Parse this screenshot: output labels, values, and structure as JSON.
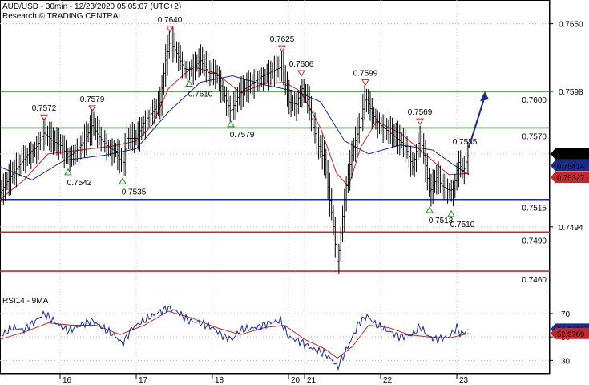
{
  "header": {
    "symbol_line": "AUD/USD - 30min - 12/23/2020 05:05:07 (UTC+2)",
    "research_line": "Research © TRADING CENTRAL"
  },
  "chart_data": [
    {
      "type": "candlestick",
      "title": "AUD/USD - 30min - 12/23/2020 05:05:07 (UTC+2)",
      "x_ticks": [
        "16",
        "17",
        "18",
        "20",
        "21",
        "22",
        "23"
      ],
      "y_ticks": [
        "0.7650",
        "0.7598",
        "0.7550",
        "0.7494"
      ],
      "ylim": [
        0.7444,
        0.7667
      ],
      "price_path": [
        [
          0,
          0.752
        ],
        [
          8,
          0.7528
        ],
        [
          20,
          0.7538
        ],
        [
          35,
          0.755
        ],
        [
          45,
          0.7555
        ],
        [
          55,
          0.7566
        ],
        [
          65,
          0.756
        ],
        [
          75,
          0.7557
        ],
        [
          85,
          0.7548
        ],
        [
          95,
          0.7552
        ],
        [
          105,
          0.756
        ],
        [
          115,
          0.7572
        ],
        [
          125,
          0.7562
        ],
        [
          135,
          0.7555
        ],
        [
          145,
          0.7552
        ],
        [
          153,
          0.754
        ],
        [
          158,
          0.7562
        ],
        [
          170,
          0.7562
        ],
        [
          180,
          0.7575
        ],
        [
          190,
          0.7582
        ],
        [
          200,
          0.759
        ],
        [
          206,
          0.762
        ],
        [
          212,
          0.7637
        ],
        [
          220,
          0.7628
        ],
        [
          230,
          0.7615
        ],
        [
          238,
          0.7615
        ],
        [
          250,
          0.7622
        ],
        [
          260,
          0.7612
        ],
        [
          270,
          0.7612
        ],
        [
          280,
          0.7595
        ],
        [
          288,
          0.7582
        ],
        [
          296,
          0.7593
        ],
        [
          305,
          0.76
        ],
        [
          315,
          0.7604
        ],
        [
          325,
          0.7609
        ],
        [
          335,
          0.7612
        ],
        [
          345,
          0.7615
        ],
        [
          352,
          0.7617
        ],
        [
          360,
          0.759
        ],
        [
          370,
          0.7588
        ],
        [
          376,
          0.7601
        ],
        [
          383,
          0.7594
        ],
        [
          390,
          0.7572
        ],
        [
          398,
          0.7555
        ],
        [
          405,
          0.7545
        ],
        [
          410,
          0.752
        ],
        [
          415,
          0.75
        ],
        [
          421,
          0.7465
        ],
        [
          428,
          0.7505
        ],
        [
          433,
          0.753
        ],
        [
          440,
          0.7552
        ],
        [
          448,
          0.757
        ],
        [
          456,
          0.7594
        ],
        [
          465,
          0.758
        ],
        [
          475,
          0.7572
        ],
        [
          485,
          0.7567
        ],
        [
          495,
          0.7562
        ],
        [
          505,
          0.7557
        ],
        [
          515,
          0.754
        ],
        [
          524,
          0.7564
        ],
        [
          530,
          0.7545
        ],
        [
          536,
          0.752
        ],
        [
          545,
          0.7532
        ],
        [
          552,
          0.7525
        ],
        [
          560,
          0.7522
        ],
        [
          566,
          0.7523
        ],
        [
          572,
          0.7544
        ],
        [
          578,
          0.7536
        ],
        [
          585,
          0.7551
        ]
      ],
      "ma_fast": [
        [
          0,
          0.7515
        ],
        [
          30,
          0.753
        ],
        [
          60,
          0.755
        ],
        [
          100,
          0.7553
        ],
        [
          140,
          0.7556
        ],
        [
          170,
          0.756
        ],
        [
          190,
          0.7572
        ],
        [
          210,
          0.76
        ],
        [
          240,
          0.7617
        ],
        [
          270,
          0.7612
        ],
        [
          300,
          0.7597
        ],
        [
          330,
          0.7604
        ],
        [
          355,
          0.7605
        ],
        [
          375,
          0.7598
        ],
        [
          400,
          0.757
        ],
        [
          420,
          0.7535
        ],
        [
          435,
          0.7525
        ],
        [
          450,
          0.7555
        ],
        [
          470,
          0.7575
        ],
        [
          500,
          0.7566
        ],
        [
          530,
          0.755
        ],
        [
          560,
          0.7534
        ],
        [
          585,
          0.7535
        ]
      ],
      "ma_slow": [
        [
          0,
          0.754
        ],
        [
          40,
          0.753
        ],
        [
          80,
          0.7545
        ],
        [
          130,
          0.7549
        ],
        [
          170,
          0.7554
        ],
        [
          210,
          0.7582
        ],
        [
          250,
          0.7605
        ],
        [
          290,
          0.761
        ],
        [
          330,
          0.7603
        ],
        [
          370,
          0.7598
        ],
        [
          400,
          0.759
        ],
        [
          430,
          0.756
        ],
        [
          460,
          0.755
        ],
        [
          500,
          0.7557
        ],
        [
          540,
          0.7553
        ],
        [
          570,
          0.754
        ],
        [
          585,
          0.7534
        ]
      ],
      "levels": [
        {
          "label": "0.7600",
          "value": 0.7598,
          "color": "#2b8a2b"
        },
        {
          "label": "0.7570",
          "value": 0.757,
          "color": "#2b8a2b"
        },
        {
          "label": "0.7515",
          "value": 0.7515,
          "color": "#1c2a88"
        },
        {
          "label": "0.7490",
          "value": 0.749,
          "color": "#c0282d"
        },
        {
          "label": "0.7460",
          "value": 0.746,
          "color": "#c0282d"
        }
      ],
      "price_tags": [
        {
          "label": "0.75503",
          "value": 0.755,
          "color": "#000000"
        },
        {
          "label": "0.75414",
          "value": 0.7541,
          "color": "#1c2a88"
        },
        {
          "label": "0.75327",
          "value": 0.7532,
          "color": "#c0282d"
        }
      ],
      "annotations": [
        {
          "label": "0.7572",
          "x": 55,
          "value": 0.7572,
          "kind": "high"
        },
        {
          "label": "0.7579",
          "x": 115,
          "value": 0.7579,
          "kind": "high"
        },
        {
          "label": "0.7640",
          "x": 212,
          "value": 0.764,
          "kind": "high"
        },
        {
          "label": "0.7625",
          "x": 352,
          "value": 0.7625,
          "kind": "high"
        },
        {
          "label": "0.7606",
          "x": 376,
          "value": 0.7606,
          "kind": "high"
        },
        {
          "label": "0.7599",
          "x": 456,
          "value": 0.7599,
          "kind": "high"
        },
        {
          "label": "0.7569",
          "x": 524,
          "value": 0.7569,
          "kind": "high"
        },
        {
          "label": "0.7555",
          "x": 580,
          "value": 0.7555,
          "kind": "label"
        },
        {
          "label": "0.7542",
          "x": 85,
          "value": 0.7542,
          "kind": "low"
        },
        {
          "label": "0.7535",
          "x": 153,
          "value": 0.7535,
          "kind": "low"
        },
        {
          "label": "0.7610",
          "x": 236,
          "value": 0.761,
          "kind": "low"
        },
        {
          "label": "0.7579",
          "x": 288,
          "value": 0.7579,
          "kind": "low"
        },
        {
          "label": "0.7513",
          "x": 536,
          "value": 0.7513,
          "kind": "low"
        },
        {
          "label": "0.7510",
          "x": 563,
          "value": 0.751,
          "kind": "low"
        }
      ],
      "forecast_arrow": {
        "from": [
          585,
          0.7555
        ],
        "to": [
          605,
          0.7598
        ],
        "color": "#1c2a88"
      }
    },
    {
      "type": "line",
      "title": "RSI14 - 9MA",
      "y_ticks": [
        "70",
        "50",
        "30"
      ],
      "ylim": [
        20,
        85
      ],
      "rsi": [
        [
          0,
          50
        ],
        [
          15,
          58
        ],
        [
          30,
          56
        ],
        [
          45,
          64
        ],
        [
          55,
          70
        ],
        [
          70,
          62
        ],
        [
          85,
          55
        ],
        [
          100,
          60
        ],
        [
          115,
          64
        ],
        [
          130,
          57
        ],
        [
          145,
          50
        ],
        [
          153,
          44
        ],
        [
          165,
          58
        ],
        [
          180,
          64
        ],
        [
          195,
          70
        ],
        [
          210,
          75
        ],
        [
          220,
          72
        ],
        [
          235,
          64
        ],
        [
          250,
          62
        ],
        [
          265,
          58
        ],
        [
          280,
          50
        ],
        [
          290,
          48
        ],
        [
          300,
          56
        ],
        [
          320,
          58
        ],
        [
          335,
          62
        ],
        [
          350,
          64
        ],
        [
          360,
          50
        ],
        [
          375,
          46
        ],
        [
          390,
          40
        ],
        [
          405,
          36
        ],
        [
          415,
          30
        ],
        [
          421,
          24
        ],
        [
          430,
          36
        ],
        [
          440,
          50
        ],
        [
          448,
          62
        ],
        [
          458,
          68
        ],
        [
          470,
          60
        ],
        [
          485,
          55
        ],
        [
          500,
          50
        ],
        [
          515,
          52
        ],
        [
          524,
          59
        ],
        [
          535,
          50
        ],
        [
          545,
          48
        ],
        [
          560,
          50
        ],
        [
          570,
          58
        ],
        [
          575,
          52
        ],
        [
          585,
          56.73
        ]
      ],
      "rsi_ma": [
        [
          0,
          48
        ],
        [
          30,
          54
        ],
        [
          60,
          62
        ],
        [
          90,
          60
        ],
        [
          120,
          60
        ],
        [
          150,
          52
        ],
        [
          180,
          60
        ],
        [
          210,
          72
        ],
        [
          240,
          66
        ],
        [
          270,
          58
        ],
        [
          300,
          52
        ],
        [
          330,
          58
        ],
        [
          355,
          60
        ],
        [
          380,
          48
        ],
        [
          405,
          40
        ],
        [
          421,
          32
        ],
        [
          440,
          42
        ],
        [
          460,
          60
        ],
        [
          485,
          58
        ],
        [
          510,
          52
        ],
        [
          535,
          50
        ],
        [
          560,
          49
        ],
        [
          585,
          52.98
        ]
      ],
      "tags": [
        {
          "label": "56.7279",
          "value": 56.73,
          "color": "#1c2a88"
        },
        {
          "label": "52.9789",
          "value": 52.98,
          "color": "#c0282d"
        }
      ]
    }
  ]
}
